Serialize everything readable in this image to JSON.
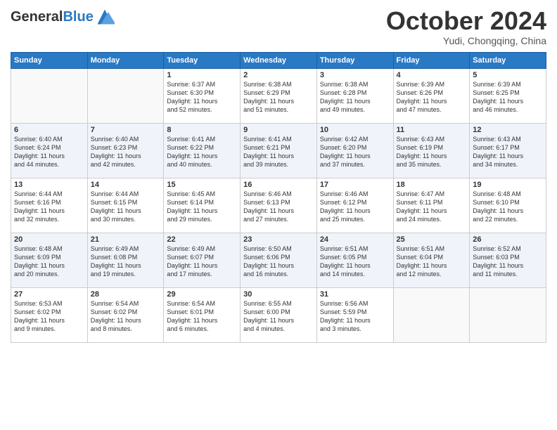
{
  "header": {
    "logo_general": "General",
    "logo_blue": "Blue",
    "month_title": "October 2024",
    "location": "Yudi, Chongqing, China"
  },
  "days_of_week": [
    "Sunday",
    "Monday",
    "Tuesday",
    "Wednesday",
    "Thursday",
    "Friday",
    "Saturday"
  ],
  "weeks": [
    [
      {
        "day": "",
        "info": ""
      },
      {
        "day": "",
        "info": ""
      },
      {
        "day": "1",
        "info": "Sunrise: 6:37 AM\nSunset: 6:30 PM\nDaylight: 11 hours\nand 52 minutes."
      },
      {
        "day": "2",
        "info": "Sunrise: 6:38 AM\nSunset: 6:29 PM\nDaylight: 11 hours\nand 51 minutes."
      },
      {
        "day": "3",
        "info": "Sunrise: 6:38 AM\nSunset: 6:28 PM\nDaylight: 11 hours\nand 49 minutes."
      },
      {
        "day": "4",
        "info": "Sunrise: 6:39 AM\nSunset: 6:26 PM\nDaylight: 11 hours\nand 47 minutes."
      },
      {
        "day": "5",
        "info": "Sunrise: 6:39 AM\nSunset: 6:25 PM\nDaylight: 11 hours\nand 46 minutes."
      }
    ],
    [
      {
        "day": "6",
        "info": "Sunrise: 6:40 AM\nSunset: 6:24 PM\nDaylight: 11 hours\nand 44 minutes."
      },
      {
        "day": "7",
        "info": "Sunrise: 6:40 AM\nSunset: 6:23 PM\nDaylight: 11 hours\nand 42 minutes."
      },
      {
        "day": "8",
        "info": "Sunrise: 6:41 AM\nSunset: 6:22 PM\nDaylight: 11 hours\nand 40 minutes."
      },
      {
        "day": "9",
        "info": "Sunrise: 6:41 AM\nSunset: 6:21 PM\nDaylight: 11 hours\nand 39 minutes."
      },
      {
        "day": "10",
        "info": "Sunrise: 6:42 AM\nSunset: 6:20 PM\nDaylight: 11 hours\nand 37 minutes."
      },
      {
        "day": "11",
        "info": "Sunrise: 6:43 AM\nSunset: 6:19 PM\nDaylight: 11 hours\nand 35 minutes."
      },
      {
        "day": "12",
        "info": "Sunrise: 6:43 AM\nSunset: 6:17 PM\nDaylight: 11 hours\nand 34 minutes."
      }
    ],
    [
      {
        "day": "13",
        "info": "Sunrise: 6:44 AM\nSunset: 6:16 PM\nDaylight: 11 hours\nand 32 minutes."
      },
      {
        "day": "14",
        "info": "Sunrise: 6:44 AM\nSunset: 6:15 PM\nDaylight: 11 hours\nand 30 minutes."
      },
      {
        "day": "15",
        "info": "Sunrise: 6:45 AM\nSunset: 6:14 PM\nDaylight: 11 hours\nand 29 minutes."
      },
      {
        "day": "16",
        "info": "Sunrise: 6:46 AM\nSunset: 6:13 PM\nDaylight: 11 hours\nand 27 minutes."
      },
      {
        "day": "17",
        "info": "Sunrise: 6:46 AM\nSunset: 6:12 PM\nDaylight: 11 hours\nand 25 minutes."
      },
      {
        "day": "18",
        "info": "Sunrise: 6:47 AM\nSunset: 6:11 PM\nDaylight: 11 hours\nand 24 minutes."
      },
      {
        "day": "19",
        "info": "Sunrise: 6:48 AM\nSunset: 6:10 PM\nDaylight: 11 hours\nand 22 minutes."
      }
    ],
    [
      {
        "day": "20",
        "info": "Sunrise: 6:48 AM\nSunset: 6:09 PM\nDaylight: 11 hours\nand 20 minutes."
      },
      {
        "day": "21",
        "info": "Sunrise: 6:49 AM\nSunset: 6:08 PM\nDaylight: 11 hours\nand 19 minutes."
      },
      {
        "day": "22",
        "info": "Sunrise: 6:49 AM\nSunset: 6:07 PM\nDaylight: 11 hours\nand 17 minutes."
      },
      {
        "day": "23",
        "info": "Sunrise: 6:50 AM\nSunset: 6:06 PM\nDaylight: 11 hours\nand 16 minutes."
      },
      {
        "day": "24",
        "info": "Sunrise: 6:51 AM\nSunset: 6:05 PM\nDaylight: 11 hours\nand 14 minutes."
      },
      {
        "day": "25",
        "info": "Sunrise: 6:51 AM\nSunset: 6:04 PM\nDaylight: 11 hours\nand 12 minutes."
      },
      {
        "day": "26",
        "info": "Sunrise: 6:52 AM\nSunset: 6:03 PM\nDaylight: 11 hours\nand 11 minutes."
      }
    ],
    [
      {
        "day": "27",
        "info": "Sunrise: 6:53 AM\nSunset: 6:02 PM\nDaylight: 11 hours\nand 9 minutes."
      },
      {
        "day": "28",
        "info": "Sunrise: 6:54 AM\nSunset: 6:02 PM\nDaylight: 11 hours\nand 8 minutes."
      },
      {
        "day": "29",
        "info": "Sunrise: 6:54 AM\nSunset: 6:01 PM\nDaylight: 11 hours\nand 6 minutes."
      },
      {
        "day": "30",
        "info": "Sunrise: 6:55 AM\nSunset: 6:00 PM\nDaylight: 11 hours\nand 4 minutes."
      },
      {
        "day": "31",
        "info": "Sunrise: 6:56 AM\nSunset: 5:59 PM\nDaylight: 11 hours\nand 3 minutes."
      },
      {
        "day": "",
        "info": ""
      },
      {
        "day": "",
        "info": ""
      }
    ]
  ]
}
